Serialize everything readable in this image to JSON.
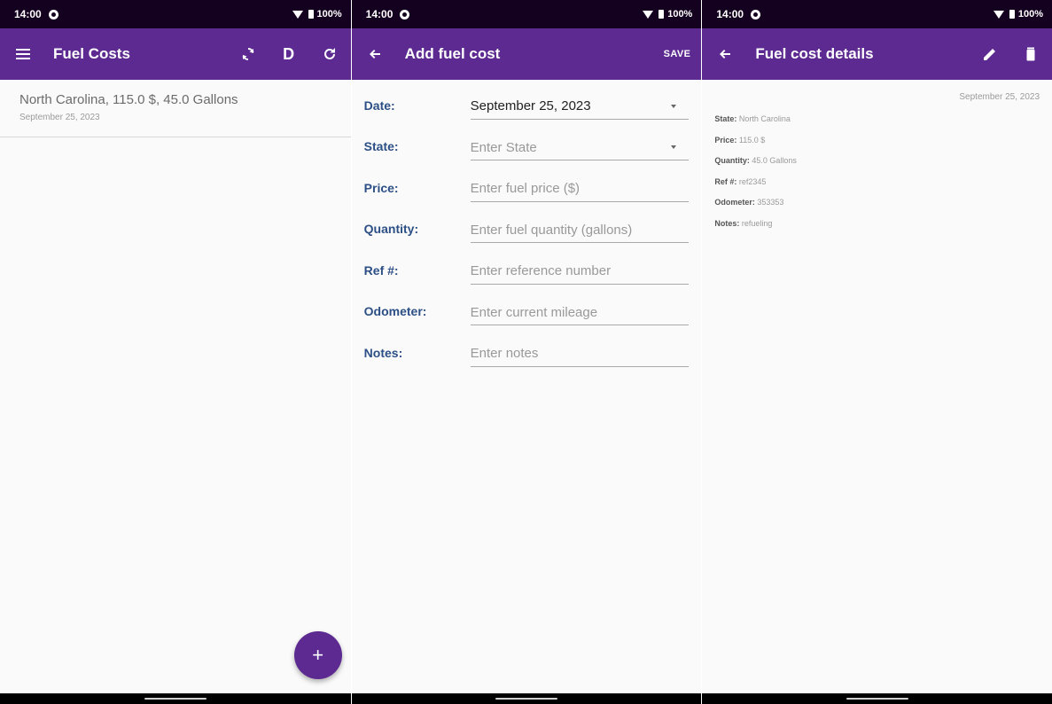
{
  "status_bar": {
    "time": "14:00",
    "battery": "100%"
  },
  "screen1": {
    "title": "Fuel Costs",
    "action_d_label": "D",
    "list": [
      {
        "primary": "North Carolina, 115.0 $, 45.0 Gallons",
        "secondary": "September 25, 2023"
      }
    ],
    "fab_label": "+"
  },
  "screen2": {
    "title": "Add fuel cost",
    "save_label": "SAVE",
    "fields": [
      {
        "label": "Date:",
        "value": "September 25, 2023",
        "dropdown": true
      },
      {
        "label": "State:",
        "placeholder": "Enter State",
        "dropdown": true
      },
      {
        "label": "Price:",
        "placeholder": "Enter fuel price ($)"
      },
      {
        "label": "Quantity:",
        "placeholder": "Enter fuel quantity (gallons)"
      },
      {
        "label": "Ref #:",
        "placeholder": "Enter reference number"
      },
      {
        "label": "Odometer:",
        "placeholder": "Enter current mileage"
      },
      {
        "label": "Notes:",
        "placeholder": "Enter notes"
      }
    ]
  },
  "screen3": {
    "title": "Fuel cost details",
    "date": "September 25, 2023",
    "details": [
      {
        "label": "State:",
        "value": "North Carolina"
      },
      {
        "label": "Price:",
        "value": "115.0 $"
      },
      {
        "label": "Quantity:",
        "value": "45.0 Gallons"
      },
      {
        "label": "Ref #:",
        "value": "ref2345"
      },
      {
        "label": "Odometer:",
        "value": "353353"
      },
      {
        "label": "Notes:",
        "value": "refueling"
      }
    ]
  },
  "colors": {
    "app_bar": "#5c2a91",
    "status_bar": "#14001f",
    "form_label": "#2c4f86",
    "background": "#fafafa"
  },
  "icons": [
    "menu-icon",
    "sync-icon",
    "refresh-icon",
    "back-arrow-icon",
    "edit-icon",
    "delete-icon",
    "add-icon",
    "wifi-icon",
    "battery-icon",
    "dropdown-caret-icon"
  ]
}
